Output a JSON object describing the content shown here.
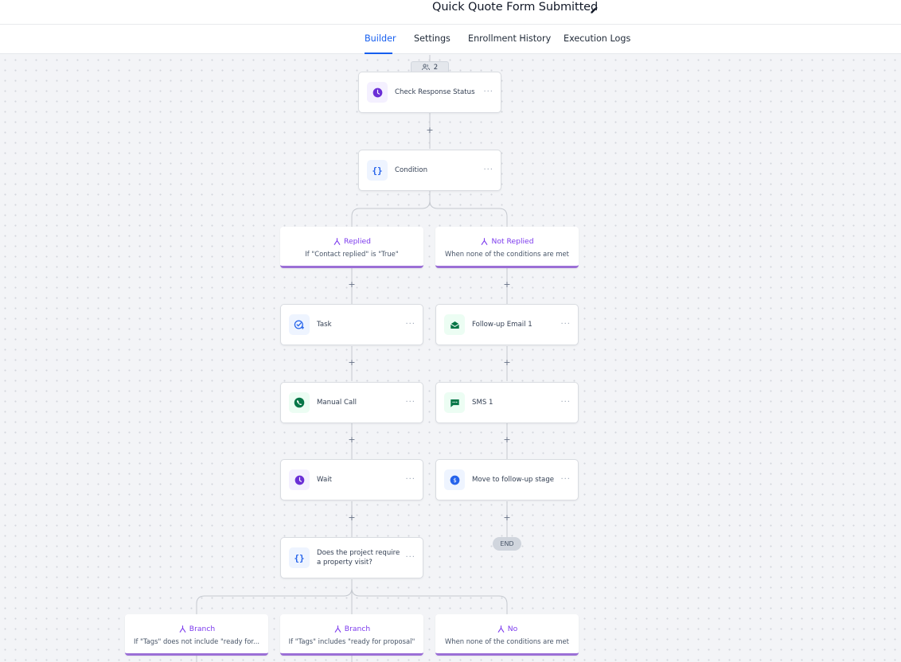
{
  "header": {
    "title": "Quick Quote Form Submitted",
    "tabs": [
      "Builder",
      "Settings",
      "Enrollment History",
      "Execution Logs"
    ]
  },
  "workflow": {
    "enrolled_count": "2",
    "nodes": {
      "check_response": "Check Response Status",
      "condition": "Condition",
      "task": "Task",
      "manual_call": "Manual Call",
      "wait": "Wait",
      "property_visit": "Does the project require a property visit?",
      "followup_email": "Follow-up Email 1",
      "sms": "SMS 1",
      "move_stage": "Move to follow-up stage"
    },
    "branches": {
      "replied": {
        "title": "Replied",
        "desc": "If \"Contact replied\" is \"True\""
      },
      "not_replied": {
        "title": "Not Replied",
        "desc": "When none of the conditions are met"
      },
      "branch_a": {
        "title": "Branch",
        "desc": "If \"Tags\" does not include \"ready for..."
      },
      "branch_b": {
        "title": "Branch",
        "desc": "If \"Tags\" includes \"ready for proposal\""
      },
      "branch_no": {
        "title": "No",
        "desc": "When none of the conditions are met"
      }
    },
    "end_label": "END",
    "menu_glyph": "···",
    "plus_glyph": "+"
  },
  "colors": {
    "accent": "#155eef",
    "branch_purple": "#7c3aed",
    "wait_purple": "#6b2fd6",
    "green": "#067647",
    "blue": "#2563eb"
  }
}
